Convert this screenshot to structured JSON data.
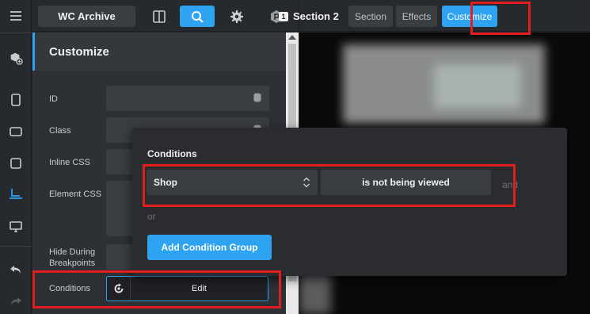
{
  "toolbar": {
    "template_name": "WC Archive",
    "section_number": "1",
    "section_name": "Section 2",
    "tabs": [
      "Section",
      "Effects",
      "Customize"
    ],
    "active_tab": "Customize"
  },
  "rail": {
    "icons": [
      "menu-icon",
      "add-element-icon",
      "phone-portrait-icon",
      "phone-landscape-icon",
      "tablet-icon",
      "laptop-icon",
      "desktop-icon",
      "undo-icon",
      "redo-icon"
    ],
    "active": "laptop-icon"
  },
  "panel": {
    "title": "Customize",
    "fields": [
      {
        "label": "ID"
      },
      {
        "label": "Class"
      },
      {
        "label": "Inline CSS"
      },
      {
        "label": "Element CSS"
      },
      {
        "label": "Hide During Breakpoints"
      }
    ],
    "conditions": {
      "label": "Conditions",
      "edit_label": "Edit"
    }
  },
  "popup": {
    "title": "Conditions",
    "condition": {
      "subject": "Shop",
      "operator": "is not being viewed"
    },
    "and_label": "and",
    "or_label": "or",
    "add_group_label": "Add Condition Group"
  },
  "colors": {
    "accent": "#2ea3f2",
    "annotation": "#e01e1e"
  }
}
